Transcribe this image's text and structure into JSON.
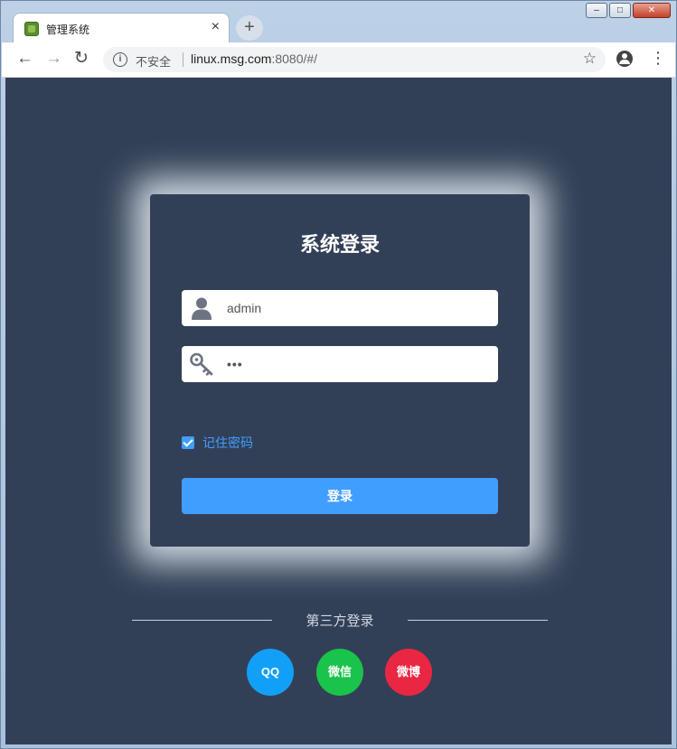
{
  "browser": {
    "tab_title": "管理系统",
    "tab_close": "×",
    "new_tab": "+",
    "security_label": "不安全",
    "url_host": "linux.msg.com",
    "url_rest": ":8080/#/",
    "window_buttons": {
      "minimize": "–",
      "maximize": "□",
      "close": "✕"
    }
  },
  "login": {
    "title": "系统登录",
    "username_value": "admin",
    "password_value": "•••",
    "remember_label": "记住密码",
    "remember_checked": true,
    "submit_label": "登录"
  },
  "third_party": {
    "label": "第三方登录",
    "providers": [
      {
        "label": "QQ",
        "color": "#12a0f7"
      },
      {
        "label": "微信",
        "color": "#1ac34a"
      },
      {
        "label": "微博",
        "color": "#ea2742"
      }
    ]
  },
  "colors": {
    "page_bg": "#324057",
    "accent": "#409eff"
  }
}
